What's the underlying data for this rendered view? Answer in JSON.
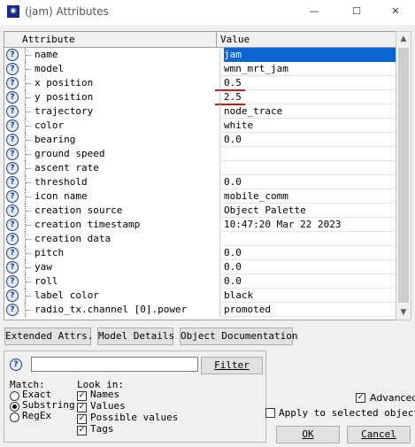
{
  "window": {
    "title": "(jam) Attributes",
    "minimize_glyph": "—",
    "maximize_glyph": "☐",
    "close_glyph": "✕"
  },
  "table": {
    "col_attribute": "Attribute",
    "col_value": "Value",
    "rows": [
      {
        "name": "name",
        "value": "jam",
        "selected": true
      },
      {
        "name": "model",
        "value": "wmn_mrt_jam"
      },
      {
        "name": "x position",
        "value": "0.5",
        "underlined": true
      },
      {
        "name": "y position",
        "value": "2.5",
        "underlined": true
      },
      {
        "name": "trajectory",
        "value": "node_trace"
      },
      {
        "name": "color",
        "value": "white"
      },
      {
        "name": "bearing",
        "value": "0.0"
      },
      {
        "name": "ground speed",
        "value": ""
      },
      {
        "name": "ascent rate",
        "value": ""
      },
      {
        "name": "threshold",
        "value": "0.0"
      },
      {
        "name": "icon name",
        "value": "mobile_comm"
      },
      {
        "name": "creation source",
        "value": "Object Palette"
      },
      {
        "name": "creation timestamp",
        "value": "10:47:20 Mar 22 2023"
      },
      {
        "name": "creation data",
        "value": ""
      },
      {
        "name": "pitch",
        "value": "0.0"
      },
      {
        "name": "yaw",
        "value": "0.0"
      },
      {
        "name": "roll",
        "value": "0.0"
      },
      {
        "name": "label color",
        "value": "black"
      },
      {
        "name": "radio_tx.channel [0].power",
        "value": "promoted"
      }
    ],
    "underline_color": "#d21919",
    "selection_color": "#0a64d2"
  },
  "buttons": {
    "extended": "Extended Attrs.",
    "model_details": "Model Details",
    "object_doc": "Object Documentation"
  },
  "filter": {
    "search_value": "",
    "filter_button": "Filter",
    "match_label": "Match:",
    "match_options": [
      "Exact",
      "Substring",
      "RegEx"
    ],
    "match_selected": "Substring",
    "look_in_label": "Look in:",
    "look_in_options": [
      {
        "label": "Names",
        "checked": true
      },
      {
        "label": "Values",
        "checked": true
      },
      {
        "label": "Possible values",
        "checked": true
      },
      {
        "label": "Tags",
        "checked": true
      }
    ]
  },
  "advanced": {
    "label": "Advanced",
    "checked": true
  },
  "apply_selected": {
    "label": "Apply to selected objects",
    "checked": false
  },
  "ok_button": "OK",
  "cancel_button": "Cancel"
}
